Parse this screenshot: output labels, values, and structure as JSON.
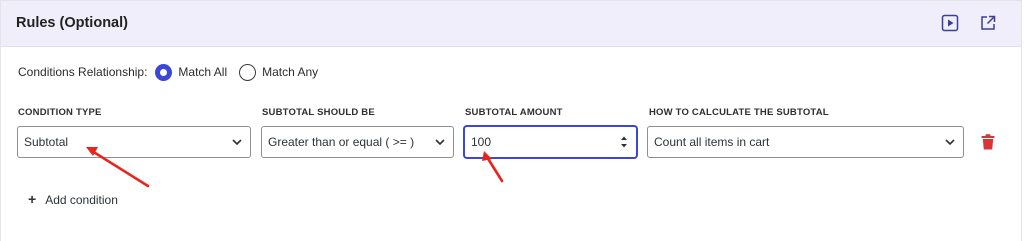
{
  "panel": {
    "title": "Rules (Optional)",
    "header_icons": [
      "play-icon",
      "external-link-icon"
    ]
  },
  "relationship": {
    "label": "Conditions Relationship:",
    "options": [
      {
        "label": "Match All",
        "selected": true
      },
      {
        "label": "Match Any",
        "selected": false
      }
    ]
  },
  "condition": {
    "columns": [
      "CONDITION TYPE",
      "SUBTOTAL SHOULD BE",
      "SUBTOTAL AMOUNT",
      "HOW TO CALCULATE THE SUBTOTAL"
    ],
    "condition_type": "Subtotal",
    "operator": "Greater than or equal ( >= )",
    "amount": "100",
    "calculation": "Count all items in cart"
  },
  "add_condition": {
    "icon": "+",
    "label": "Add condition"
  },
  "colors": {
    "accent": "#3b47d6",
    "header_bg": "#f0eefb",
    "delete": "#d63638",
    "annotation_arrow": "#e8251c"
  }
}
